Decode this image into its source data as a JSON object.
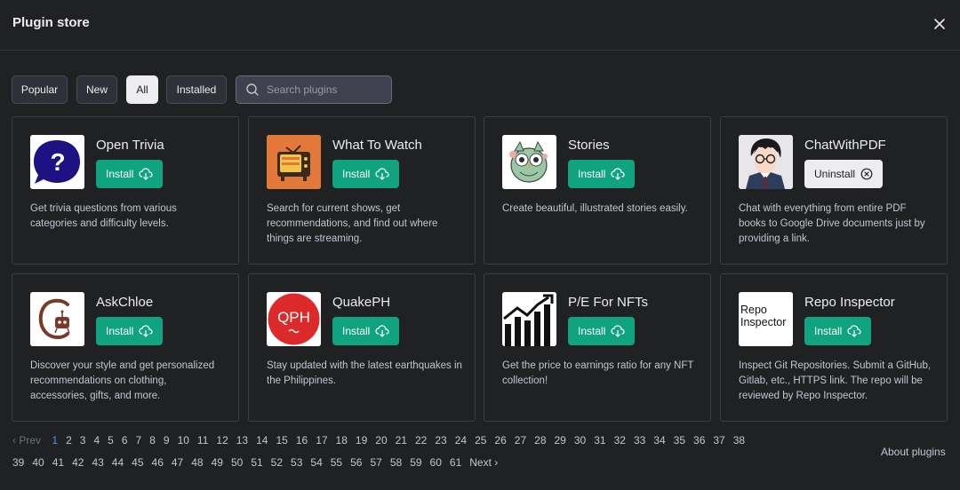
{
  "header": {
    "title": "Plugin store"
  },
  "filters": {
    "tabs": [
      {
        "label": "Popular"
      },
      {
        "label": "New"
      },
      {
        "label": "All"
      },
      {
        "label": "Installed"
      }
    ],
    "search_placeholder": "Search plugins"
  },
  "plugins": [
    {
      "name": "Open Trivia",
      "action": "Install",
      "description": "Get trivia questions from various categories and difficulty levels.",
      "logo": "question-mark-bubble-icon"
    },
    {
      "name": "What To Watch",
      "action": "Install",
      "description": "Search for current shows, get recommendations, and find out where things are streaming.",
      "logo": "retro-tv-icon"
    },
    {
      "name": "Stories",
      "action": "Install",
      "description": "Create beautiful, illustrated stories easily.",
      "logo": "owl-illustration-icon"
    },
    {
      "name": "ChatWithPDF",
      "action": "Uninstall",
      "description": "Chat with everything from entire PDF books to Google Drive documents just by providing a link.",
      "logo": "anime-character-icon"
    },
    {
      "name": "AskChloe",
      "action": "Install",
      "description": "Discover your style and get personalized recommendations on clothing, accessories, gifts, and more.",
      "logo": "chloe-c-robot-icon"
    },
    {
      "name": "QuakePH",
      "action": "Install",
      "description": "Stay updated with the latest earthquakes in the Philippines.",
      "logo": "qph-circle-icon",
      "logo_text": "QPH"
    },
    {
      "name": "P/E For NFTs",
      "action": "Install",
      "description": "Get the price to earnings ratio for any NFT collection!",
      "logo": "bar-trend-icon"
    },
    {
      "name": "Repo Inspector",
      "action": "Install",
      "description": "Inspect Git Repositories. Submit a GitHub, Gitlab, etc., HTTPS link. The repo will be reviewed by Repo Inspector.",
      "logo": "repo-inspector-text-icon",
      "logo_text_1": "Repo",
      "logo_text_2": "Inspector"
    }
  ],
  "pagination": {
    "prev": "Prev",
    "next": "Next",
    "current_page": 1,
    "row1": [
      "1",
      "2",
      "3",
      "4",
      "5",
      "6",
      "7",
      "8",
      "9",
      "10",
      "11",
      "12",
      "13",
      "14",
      "15",
      "16",
      "17",
      "18",
      "19",
      "20",
      "21",
      "22",
      "23",
      "24",
      "25",
      "26",
      "27",
      "28",
      "29",
      "30",
      "31",
      "32",
      "33",
      "34",
      "35",
      "36",
      "37",
      "38"
    ],
    "row2": [
      "39",
      "40",
      "41",
      "42",
      "43",
      "44",
      "45",
      "46",
      "47",
      "48",
      "49",
      "50",
      "51",
      "52",
      "53",
      "54",
      "55",
      "56",
      "57",
      "58",
      "59",
      "60",
      "61"
    ]
  },
  "footer": {
    "about_label": "About plugins"
  },
  "colors": {
    "install_green": "#10a37f",
    "background": "#202123",
    "current_page_blue": "#5b8def"
  }
}
